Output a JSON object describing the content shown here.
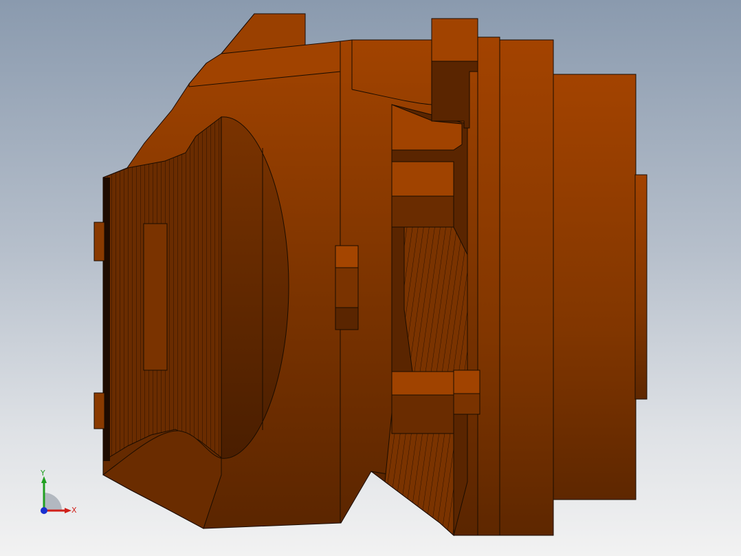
{
  "viewport": {
    "background_top": "#8a9aae",
    "background_bottom": "#f2f2f2"
  },
  "model": {
    "part_color_light": "#a64500",
    "part_color_mid": "#8a3a00",
    "part_color_dark": "#5a2500",
    "edge_color": "#1a0c00"
  },
  "triad": {
    "x_label": "X",
    "y_label": "Y",
    "x_color": "#d0201a",
    "y_color": "#20a020",
    "z_color": "#1a2fd0"
  }
}
